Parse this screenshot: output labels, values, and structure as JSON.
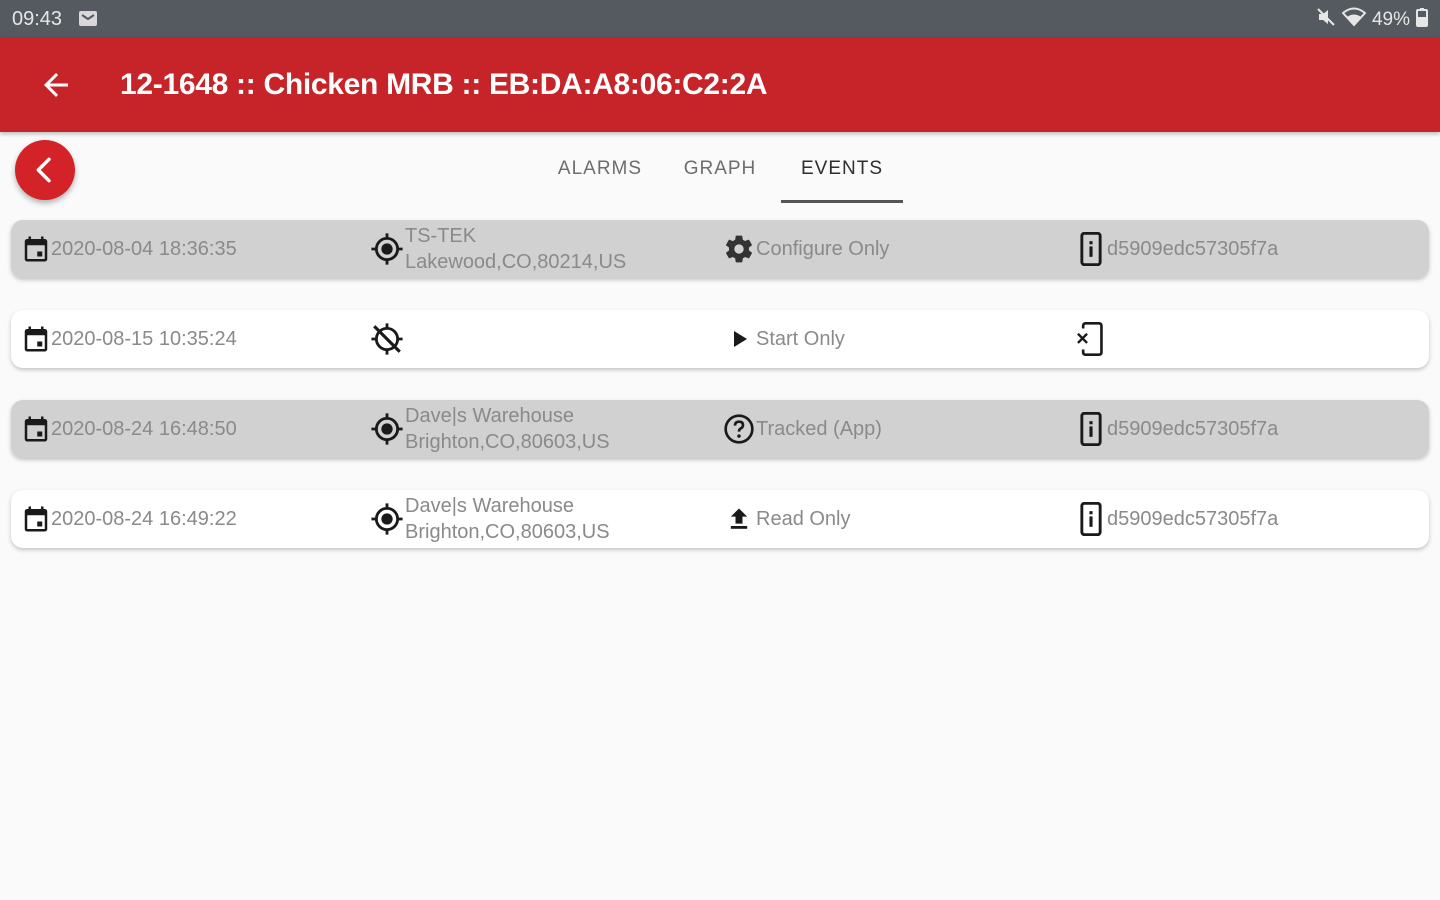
{
  "status_bar": {
    "time": "09:43",
    "battery": "49%",
    "icons": [
      "message-icon",
      "mute-icon",
      "wifi-icon",
      "battery-icon"
    ]
  },
  "app_bar": {
    "title": "12-1648 :: Chicken MRB :: EB:DA:A8:06:C2:2A",
    "color": "#c62428"
  },
  "tabs": [
    {
      "label": "ALARMS",
      "active": false
    },
    {
      "label": "GRAPH",
      "active": false
    },
    {
      "label": "EVENTS",
      "active": true
    }
  ],
  "events": [
    {
      "timestamp": "2020-08-04 18:36:35",
      "location_icon": "gps-fixed-icon",
      "location_line1": "TS-TEK",
      "location_line2": "Lakewood,CO,80214,US",
      "action_icon": "gear-icon",
      "action": "Configure Only",
      "device_icon": "phone-info-icon",
      "device_id": "d5909edc57305f7a"
    },
    {
      "timestamp": "2020-08-15 10:35:24",
      "location_icon": "gps-off-icon",
      "location_line1": "",
      "location_line2": "",
      "action_icon": "play-icon",
      "action": "Start Only",
      "device_icon": "phone-missing-icon",
      "device_id": ""
    },
    {
      "timestamp": "2020-08-24 16:48:50",
      "location_icon": "gps-fixed-icon",
      "location_line1": "Dave|s Warehouse",
      "location_line2": "Brighton,CO,80603,US",
      "action_icon": "help-circle-icon",
      "action": "Tracked (App)",
      "device_icon": "phone-info-icon",
      "device_id": "d5909edc57305f7a"
    },
    {
      "timestamp": "2020-08-24 16:49:22",
      "location_icon": "gps-fixed-icon",
      "location_line1": "Dave|s Warehouse",
      "location_line2": "Brighton,CO,80603,US",
      "action_icon": "upload-icon",
      "action": "Read Only",
      "device_icon": "phone-info-icon",
      "device_id": "d5909edc57305f7a"
    }
  ]
}
